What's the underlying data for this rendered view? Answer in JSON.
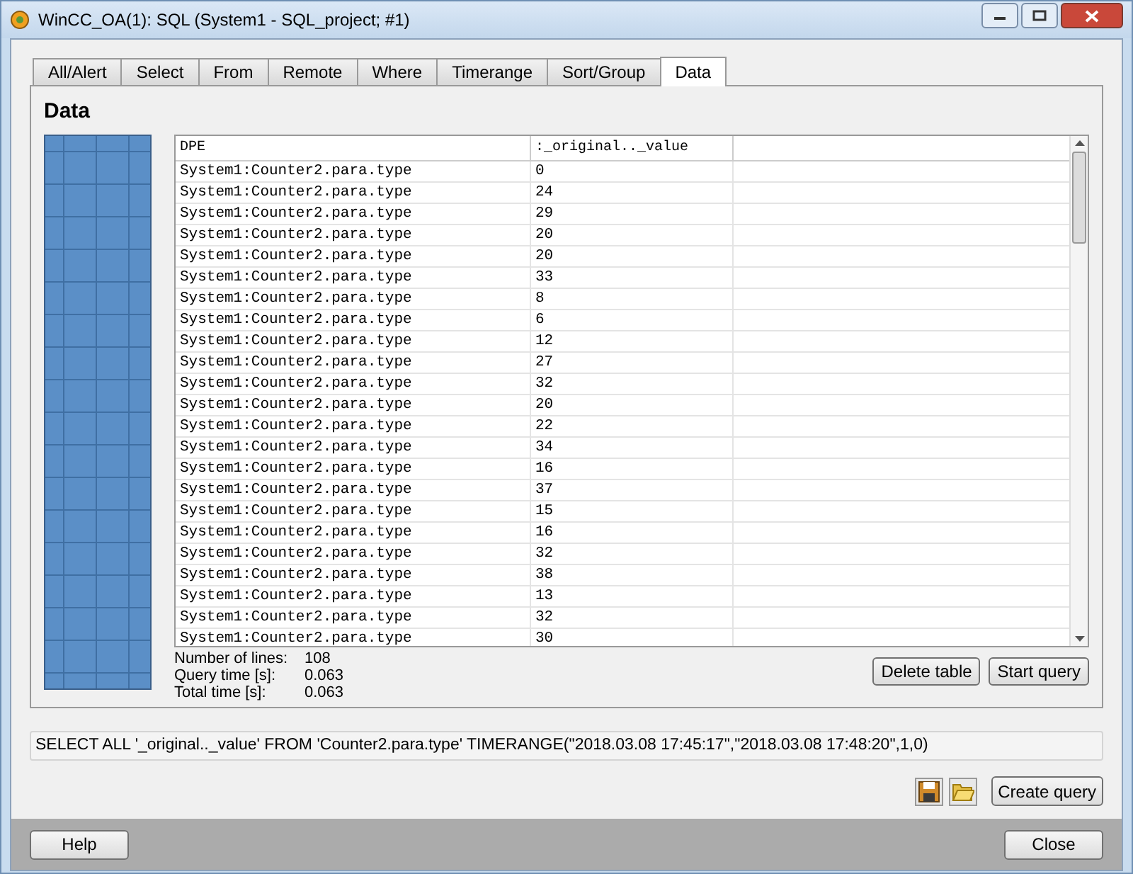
{
  "window": {
    "title": "WinCC_OA(1): SQL (System1 - SQL_project; #1)"
  },
  "tabs": [
    {
      "label": "All/Alert",
      "selected": false
    },
    {
      "label": "Select",
      "selected": false
    },
    {
      "label": "From",
      "selected": false
    },
    {
      "label": "Remote",
      "selected": false
    },
    {
      "label": "Where",
      "selected": false
    },
    {
      "label": "Timerange",
      "selected": false
    },
    {
      "label": "Sort/Group",
      "selected": false
    },
    {
      "label": "Data",
      "selected": true
    }
  ],
  "panel_title": "Data",
  "table": {
    "columns": [
      "DPE",
      ":_original.._value"
    ],
    "rows": [
      [
        "System1:Counter2.para.type",
        "0"
      ],
      [
        "System1:Counter2.para.type",
        "24"
      ],
      [
        "System1:Counter2.para.type",
        "29"
      ],
      [
        "System1:Counter2.para.type",
        "20"
      ],
      [
        "System1:Counter2.para.type",
        "20"
      ],
      [
        "System1:Counter2.para.type",
        "33"
      ],
      [
        "System1:Counter2.para.type",
        "8"
      ],
      [
        "System1:Counter2.para.type",
        "6"
      ],
      [
        "System1:Counter2.para.type",
        "12"
      ],
      [
        "System1:Counter2.para.type",
        "27"
      ],
      [
        "System1:Counter2.para.type",
        "32"
      ],
      [
        "System1:Counter2.para.type",
        "20"
      ],
      [
        "System1:Counter2.para.type",
        "22"
      ],
      [
        "System1:Counter2.para.type",
        "34"
      ],
      [
        "System1:Counter2.para.type",
        "16"
      ],
      [
        "System1:Counter2.para.type",
        "37"
      ],
      [
        "System1:Counter2.para.type",
        "15"
      ],
      [
        "System1:Counter2.para.type",
        "16"
      ],
      [
        "System1:Counter2.para.type",
        "32"
      ],
      [
        "System1:Counter2.para.type",
        "38"
      ],
      [
        "System1:Counter2.para.type",
        "13"
      ],
      [
        "System1:Counter2.para.type",
        "32"
      ],
      [
        "System1:Counter2.para.type",
        "30"
      ]
    ]
  },
  "stats": [
    {
      "label": "Number of lines:",
      "value": "108"
    },
    {
      "label": "Query time [s]:",
      "value": "0.063"
    },
    {
      "label": "Total time [s]:",
      "value": "0.063"
    }
  ],
  "table_buttons": [
    "Delete table",
    "Start query"
  ],
  "query": "SELECT ALL '_original.._value' FROM 'Counter2.para.type' TIMERANGE(\"2018.03.08 17:45:17\",\"2018.03.08 17:48:20\",1,0)",
  "create_button": "Create query",
  "footer": {
    "help": "Help",
    "close": "Close"
  }
}
